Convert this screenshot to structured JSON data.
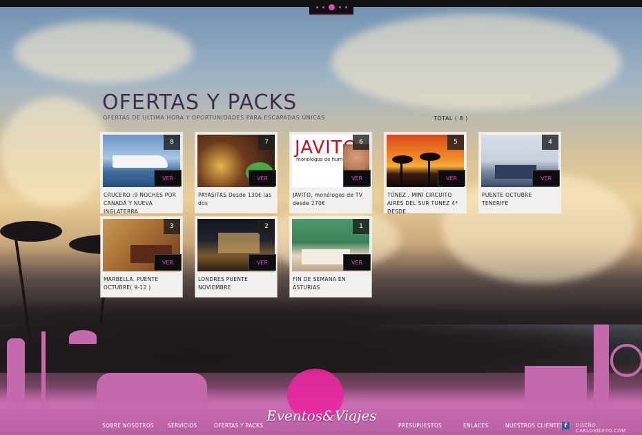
{
  "header": {
    "title": "OFERTAS Y PACKS",
    "subtitle": "OFERTAS DE ULTIMA HORA Y OPORTUNIDADES PARA ESCAPADAS ÚNICAS",
    "total": "TOTAL ( 8 )"
  },
  "cards": [
    {
      "num": "8",
      "ver": "VER",
      "caption": "CRUCERO :9 NOCHES POR CANADÁ Y NUEVA INGLATERRA"
    },
    {
      "num": "7",
      "ver": "VER",
      "caption": "PAYASITAS Desde 130€ las dos"
    },
    {
      "num": "6",
      "ver": "VER",
      "caption": "JAVITO, monólogos de TV desde 270€",
      "thumb_title": "JAVITO",
      "thumb_sub": "monólogos de humor"
    },
    {
      "num": "5",
      "ver": "VER",
      "caption": "TÚNEZ . MINI CIRCUITO AIRES DEL SUR TUNEZ 4* DESDE"
    },
    {
      "num": "4",
      "ver": "VER",
      "caption": "PUENTE OCTUBRE TENERIFE"
    },
    {
      "num": "3",
      "ver": "VER",
      "caption": "MARBELLA. PUENTE OCTUBRE( 9-12 )"
    },
    {
      "num": "2",
      "ver": "VER",
      "caption": "LONDRES PUENTE NOVIEMBRE"
    },
    {
      "num": "1",
      "ver": "VER",
      "caption": "FIN DE SEMANA EN ASTURIAS"
    }
  ],
  "footer": {
    "logo": "Eventos&Viajes",
    "nav": [
      "SOBRE NOSOTROS",
      "SERVICIOS",
      "OFERTAS Y PACKS",
      "PRESUPUESTOS",
      "ENLACES",
      "NUESTROS CLIENTES"
    ],
    "facebook": "f",
    "credit": "DISEÑO: CARLOSNIETO.COM"
  },
  "colors": {
    "accent": "#e63fc9",
    "title": "#3f2e4c",
    "footer": "#c46aac"
  }
}
